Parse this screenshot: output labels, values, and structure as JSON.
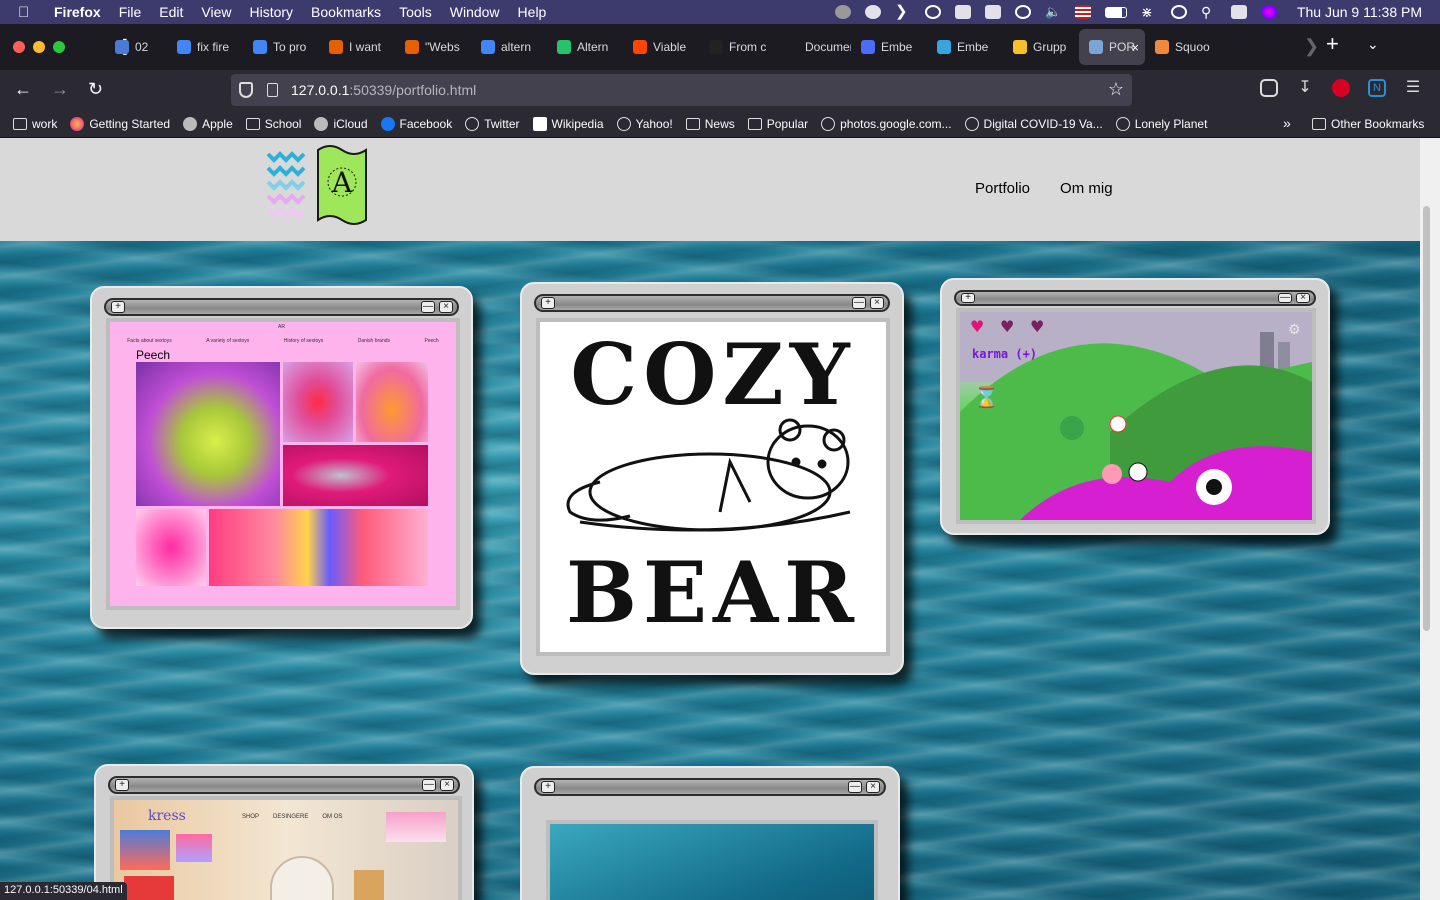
{
  "menubar": {
    "app": "Firefox",
    "items": [
      "File",
      "Edit",
      "View",
      "History",
      "Bookmarks",
      "Tools",
      "Window",
      "Help"
    ],
    "clock": "Thu Jun 9  11:38 PM"
  },
  "tabs": [
    {
      "label": "02",
      "color": "#4a7bd6"
    },
    {
      "label": "fix fire",
      "color": "#4285f4"
    },
    {
      "label": "To pro",
      "color": "#4285f4"
    },
    {
      "label": "I want",
      "color": "#e66000"
    },
    {
      "label": "\"Webs",
      "color": "#e66000"
    },
    {
      "label": "altern",
      "color": "#4285f4"
    },
    {
      "label": "Altern",
      "color": "#27c26c"
    },
    {
      "label": "Viable",
      "color": "#ff4500"
    },
    {
      "label": "From c",
      "color": "#222222"
    },
    {
      "label": "Document",
      "color": "#1c1b22"
    },
    {
      "label": "Embe",
      "color": "#4a6cf7"
    },
    {
      "label": "Embe",
      "color": "#36a6e0"
    },
    {
      "label": "Grupp",
      "color": "#f6c026"
    },
    {
      "label": "POR",
      "color": "#7aa5d6",
      "active": true
    },
    {
      "label": "Squoo",
      "color": "#f0883e"
    }
  ],
  "nav": {
    "url_host": "127.0.0.1",
    "url_path": ":50339/portfolio.html"
  },
  "bookmarks": [
    {
      "label": "work",
      "icon": "folder-icon"
    },
    {
      "label": "Getting Started",
      "icon": "firefox-icon"
    },
    {
      "label": "Apple",
      "icon": "apple-icon"
    },
    {
      "label": "School",
      "icon": "folder-icon"
    },
    {
      "label": "iCloud",
      "icon": "apple-icon"
    },
    {
      "label": "Facebook",
      "icon": "facebook-icon"
    },
    {
      "label": "Twitter",
      "icon": "globe-icon"
    },
    {
      "label": "Wikipedia",
      "icon": "wikipedia-icon"
    },
    {
      "label": "Yahoo!",
      "icon": "globe-icon"
    },
    {
      "label": "News",
      "icon": "folder-icon"
    },
    {
      "label": "Popular",
      "icon": "folder-icon"
    },
    {
      "label": "photos.google.com...",
      "icon": "globe-icon"
    },
    {
      "label": "Digital COVID-19 Va...",
      "icon": "globe-icon"
    },
    {
      "label": "Lonely Planet",
      "icon": "globe-icon"
    }
  ],
  "other_bookmarks": "Other Bookmarks",
  "site": {
    "logo_letter": "A",
    "nav": [
      "Portfolio",
      "Om mig"
    ]
  },
  "projects": {
    "peech": {
      "title": "Peech",
      "nav": [
        "Facts about sextoys",
        "A variety of sextoys",
        "History of sextoys",
        "Danish brands",
        "Peech"
      ],
      "mini": "AR"
    },
    "cozy": {
      "line1": "COZY",
      "line2": "BEAR"
    },
    "game": {
      "label": "karma (+)"
    },
    "kress": {
      "brand": "kress",
      "nav": [
        "SHOP",
        "DESINGERE",
        "OM OS"
      ]
    }
  },
  "status_url": "127.0.0.1:50339/04.html"
}
